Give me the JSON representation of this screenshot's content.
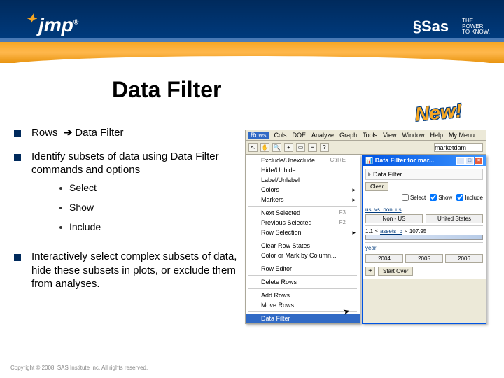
{
  "header": {
    "jmp_text": "jmp",
    "sas_text": "Sas",
    "sas_tagline": "THE\nPOWER\nTO KNOW."
  },
  "title": "Data Filter",
  "new_badge": "New!",
  "bullets": {
    "b1_pre": "Rows ",
    "b1_post": "Data Filter",
    "arrow": "➔",
    "b2": "Identify subsets of data using Data Filter commands and options",
    "b2_sub1": "Select",
    "b2_sub2": "Show",
    "b2_sub3": "Include",
    "b3": "Interactively select complex subsets of data, hide these subsets in plots, or exclude them from analyses."
  },
  "menubar": {
    "items": [
      "Rows",
      "Cols",
      "DOE",
      "Analyze",
      "Graph",
      "Tools",
      "View",
      "Window",
      "Help",
      "My Menu"
    ],
    "searchbox": "marketdam"
  },
  "menu": {
    "m1": "Exclude/Unexclude",
    "m2": "Hide/Unhide",
    "m3": "Label/Unlabel",
    "m4": "Colors",
    "m5": "Markers",
    "m6": "Next Selected",
    "m6k": "F3",
    "m7": "Previous Selected",
    "m7k": "F2",
    "m8": "Row Selection",
    "m9": "Clear Row States",
    "m10": "Color or Mark by Column...",
    "m11": "Row Editor",
    "m12": "Delete Rows",
    "m13": "Add Rows...",
    "m14": "Move Rows...",
    "m15": "Data Filter",
    "ce": "Ctrl+E"
  },
  "filter": {
    "wintitle": "Data Filter for mar...",
    "header": "Data Filter",
    "clear": "Clear",
    "cb1": "Select",
    "cb2": "Show",
    "cb3": "Include",
    "var1": "us_vs_non_us",
    "seg1": "Non - US",
    "seg2": "United States",
    "sl_lo": "1.1",
    "var2": "assets_b",
    "sl_hi": "107.95",
    "var3": "year",
    "y1": "2004",
    "y2": "2005",
    "y3": "2006",
    "plus": "+",
    "startover": "Start Over"
  },
  "footer": "Copyright © 2008, SAS Institute Inc. All rights reserved."
}
